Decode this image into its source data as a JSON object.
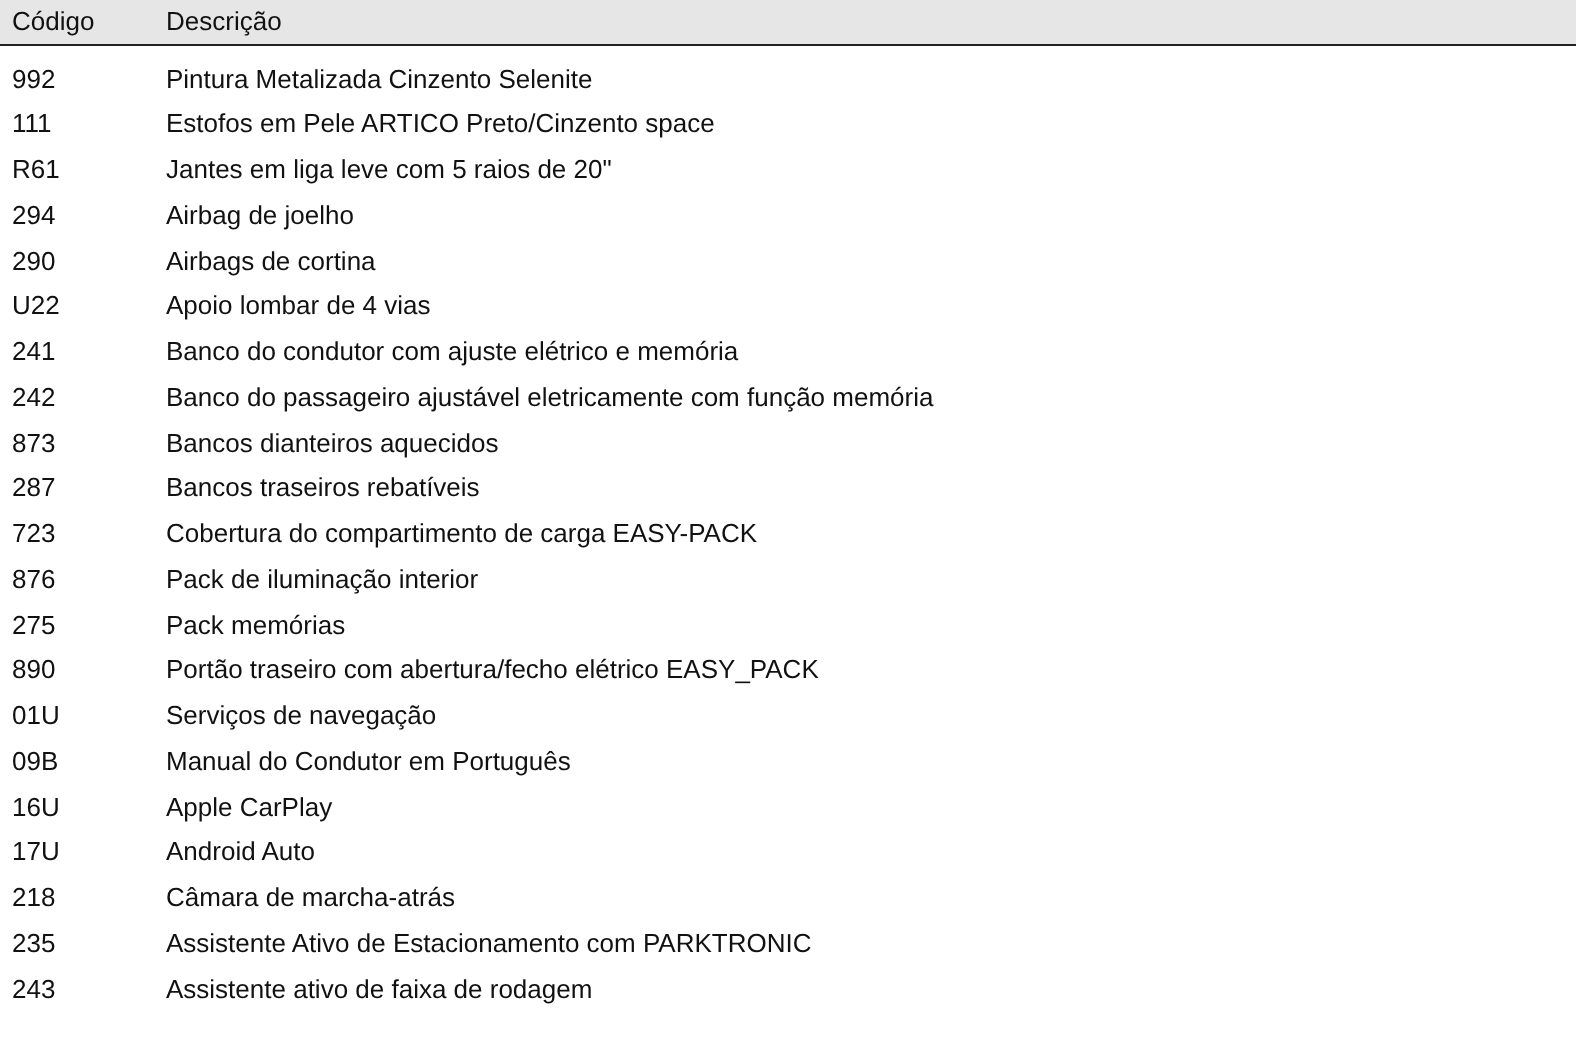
{
  "table": {
    "columns": [
      "Código",
      "Descrição"
    ],
    "rows": [
      [
        "992",
        "Pintura Metalizada Cinzento Selenite"
      ],
      [
        "111",
        "Estofos em Pele ARTICO Preto/Cinzento space"
      ],
      [
        "R61",
        "Jantes em liga leve com 5 raios de 20\""
      ],
      [
        "294",
        "Airbag de joelho"
      ],
      [
        "290",
        "Airbags de cortina"
      ],
      [
        "U22",
        "Apoio lombar de 4 vias"
      ],
      [
        "241",
        "Banco do condutor com ajuste elétrico e memória"
      ],
      [
        "242",
        "Banco do passageiro ajustável eletricamente com função memória"
      ],
      [
        "873",
        "Bancos dianteiros aquecidos"
      ],
      [
        "287",
        "Bancos traseiros rebatíveis"
      ],
      [
        "723",
        "Cobertura do compartimento de carga EASY-PACK"
      ],
      [
        "876",
        "Pack de iluminação interior"
      ],
      [
        "275",
        "Pack memórias"
      ],
      [
        "890",
        "Portão traseiro com abertura/fecho elétrico EASY_PACK"
      ],
      [
        "01U",
        "Serviços de navegação"
      ],
      [
        "09B",
        "Manual do Condutor em Português"
      ],
      [
        "16U",
        "Apple CarPlay"
      ],
      [
        "17U",
        "Android Auto"
      ],
      [
        "218",
        "Câmara de marcha-atrás"
      ],
      [
        "235",
        "Assistente Ativo de Estacionamento com PARKTRONIC"
      ],
      [
        "243",
        "Assistente ativo de faixa de rodagem"
      ]
    ]
  }
}
